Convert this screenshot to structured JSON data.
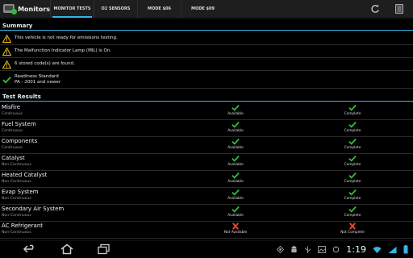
{
  "app": {
    "title": "Monitors"
  },
  "tabs": [
    {
      "label": "MONITOR TESTS",
      "active": true
    },
    {
      "label": "O2 SENSORS",
      "active": false
    },
    {
      "label": "MODE $06",
      "active": false
    },
    {
      "label": "MODE $09",
      "active": false
    }
  ],
  "summary": {
    "title": "Summary",
    "items": [
      {
        "icon": "warning-icon",
        "line1": "This vehicle is not ready for emissions testing.",
        "line2": ""
      },
      {
        "icon": "warning-icon",
        "line1": "The Malfunction Indicator Lamp (MIL) is On.",
        "line2": ""
      },
      {
        "icon": "warning-icon",
        "line1": "6 stored code(s) are found.",
        "line2": ""
      },
      {
        "icon": "check-icon",
        "line1": "Readiness Standard",
        "line2": "PA - 2001 and newer"
      }
    ]
  },
  "test_results": {
    "title": "Test Results",
    "rows": [
      {
        "name": "Misfire",
        "type": "Continuous",
        "available": "Available",
        "complete": "Complete",
        "available_ok": true,
        "complete_ok": true
      },
      {
        "name": "Fuel System",
        "type": "Continuous",
        "available": "Available",
        "complete": "Complete",
        "available_ok": true,
        "complete_ok": true
      },
      {
        "name": "Components",
        "type": "Continuous",
        "available": "Available",
        "complete": "Complete",
        "available_ok": true,
        "complete_ok": true
      },
      {
        "name": "Catalyst",
        "type": "Non-Continuous",
        "available": "Available",
        "complete": "Complete",
        "available_ok": true,
        "complete_ok": true
      },
      {
        "name": "Heated Catalyst",
        "type": "Non-Continuous",
        "available": "Available",
        "complete": "Complete",
        "available_ok": true,
        "complete_ok": true
      },
      {
        "name": "Evap System",
        "type": "Non-Continuous",
        "available": "Available",
        "complete": "Complete",
        "available_ok": true,
        "complete_ok": true
      },
      {
        "name": "Secondary Air System",
        "type": "Non-Continuous",
        "available": "Available",
        "complete": "Complete",
        "available_ok": true,
        "complete_ok": true
      },
      {
        "name": "AC Refrigerant",
        "type": "Non-Continuous",
        "available": "Not Available",
        "complete": "Not Complete",
        "available_ok": false,
        "complete_ok": false
      }
    ]
  },
  "status_bar": {
    "time": "1:19"
  },
  "colors": {
    "accent": "#33b5e5",
    "ok": "#2fbf3a",
    "fail": "#e0452c",
    "warn": "#e8c31a"
  }
}
